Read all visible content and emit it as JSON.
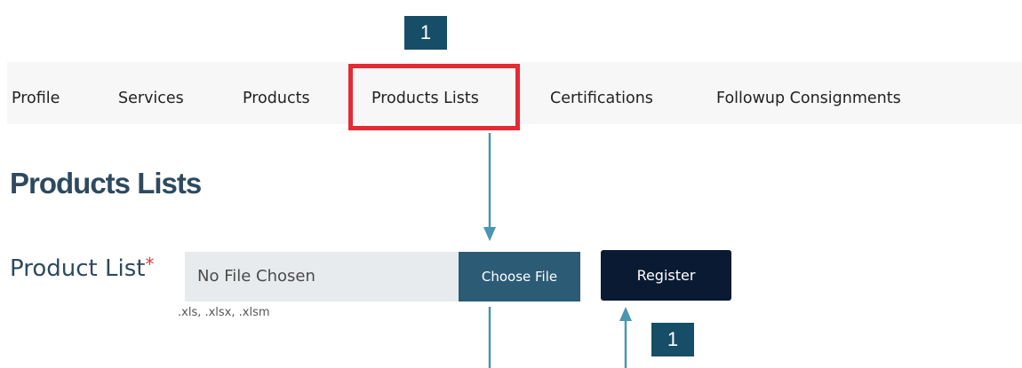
{
  "callouts": {
    "top": "1",
    "bottom": "1"
  },
  "tabs": [
    {
      "label": "Profile"
    },
    {
      "label": "Services"
    },
    {
      "label": "Products"
    },
    {
      "label": "Products Lists"
    },
    {
      "label": "Certifications"
    },
    {
      "label": "Followup Consignments"
    }
  ],
  "selected_tab": "Products Lists",
  "page": {
    "title": "Products Lists"
  },
  "form": {
    "label": "Product List",
    "required_mark": "*",
    "file_status": "No File Chosen",
    "choose_label": "Choose File",
    "accepted_types": ".xls, .xlsx, .xlsm",
    "register_label": "Register"
  },
  "colors": {
    "highlight": "#e52a33",
    "callout_badge": "#164e68",
    "arrow": "#4a95b3",
    "title": "#2d4a5f",
    "choose_button": "#2c5b76",
    "register_button": "#0b1a33"
  }
}
